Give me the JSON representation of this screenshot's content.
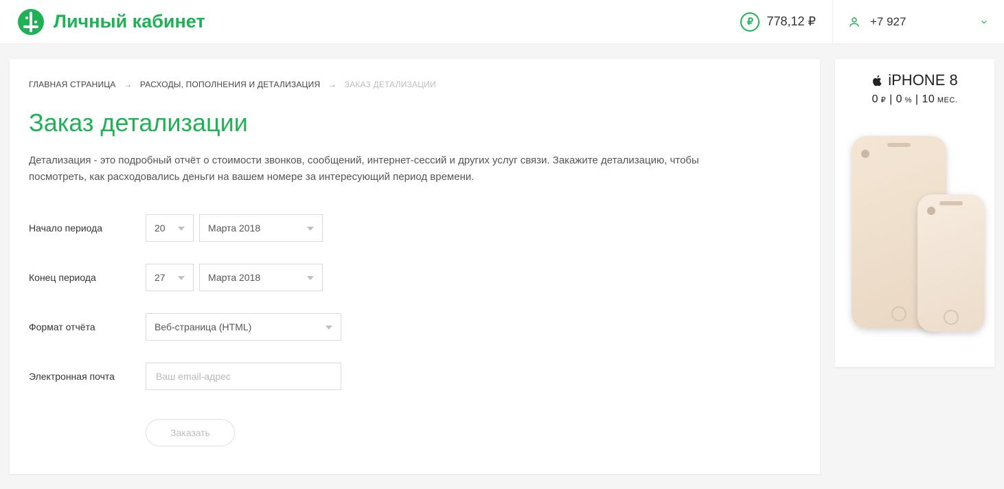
{
  "header": {
    "logo_label": "Личный кабинет",
    "balance": "778,12 ₽",
    "phone": "+7 927"
  },
  "breadcrumbs": {
    "home": "ГЛАВНАЯ СТРАНИЦА",
    "section": "РАСХОДЫ, ПОПОЛНЕНИЯ И ДЕТАЛИЗАЦИЯ",
    "current": "ЗАКАЗ ДЕТАЛИЗАЦИИ"
  },
  "page": {
    "title": "Заказ детализации",
    "description": "Детализация - это подробный отчёт о стоимости звонков, сообщений, интернет-сессий и других услуг связи. Закажите детализацию, чтобы посмотреть, как расходовались деньги на вашем номере за интересующий период времени."
  },
  "form": {
    "start_label": "Начало периода",
    "start_day": "20",
    "start_month": "Марта 2018",
    "end_label": "Конец периода",
    "end_day": "27",
    "end_month": "Марта 2018",
    "format_label": "Формат отчёта",
    "format_value": "Веб-страница (HTML)",
    "email_label": "Электронная почта",
    "email_placeholder": "Ваш email-адрес",
    "submit": "Заказать"
  },
  "ad": {
    "title": "iPHONE 8",
    "sub_price": "0",
    "sub_percent": "0",
    "sub_months": "10",
    "months_label": "МЕС."
  }
}
